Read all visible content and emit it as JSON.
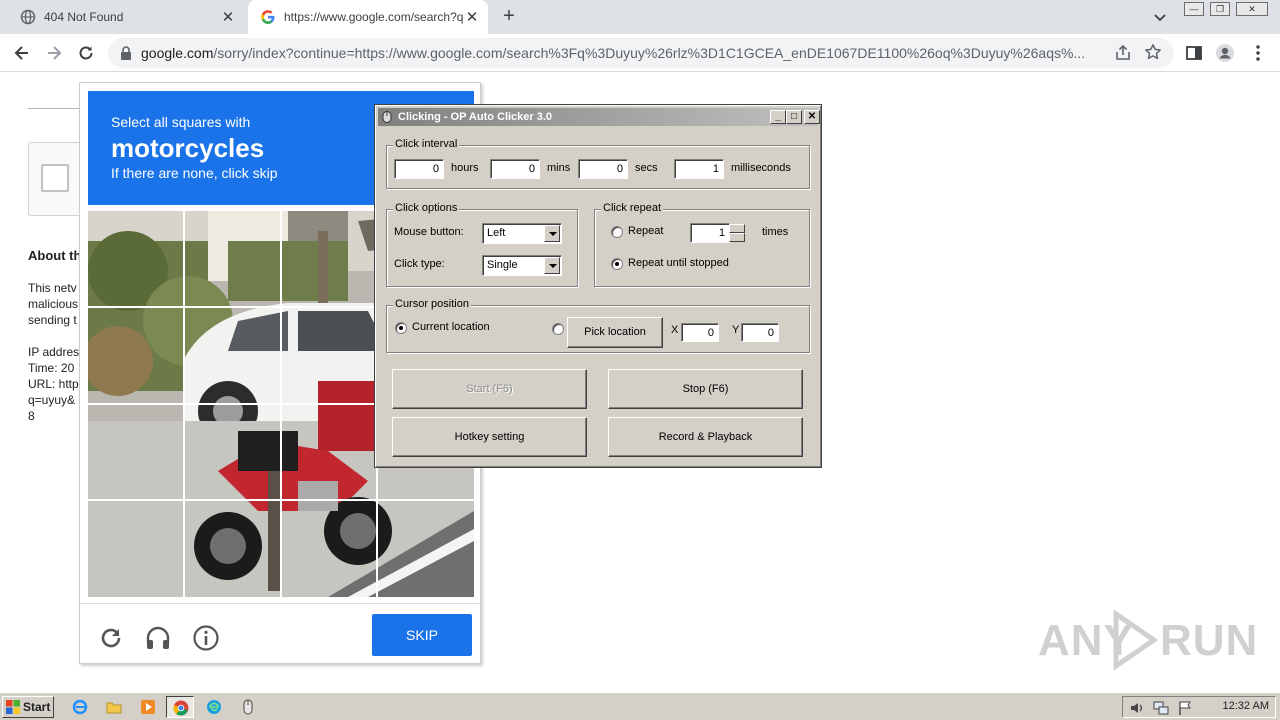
{
  "browser": {
    "tabs": [
      {
        "title": "404 Not Found",
        "active": false
      },
      {
        "title": "https://www.google.com/search?q=",
        "active": true
      }
    ],
    "url_domain": "google.com",
    "url_rest": "/sorry/index?continue=https://www.google.com/search%3Fq%3Duyuy%26rlz%3D1C1GCEA_enDE1067DE1100%26oq%3Duyuy%26aqs%..."
  },
  "page": {
    "about_heading": "About th",
    "lines_a": [
      "This netv",
      "malicious",
      "sending t"
    ],
    "lines_b": [
      "IP addres",
      "Time: 20",
      "URL: http",
      "q=uyuy&",
      "8"
    ]
  },
  "captcha": {
    "instruction": "Select all squares with",
    "target": "motorcycles",
    "subtext": "If there are none, click skip",
    "skip_label": "SKIP",
    "colors": {
      "header": "#1a73e8",
      "button": "#1a73e8"
    }
  },
  "clicker": {
    "title": "Clicking - OP Auto Clicker 3.0",
    "interval": {
      "label": "Click interval",
      "hours": "0",
      "hours_label": "hours",
      "mins": "0",
      "mins_label": "mins",
      "secs": "0",
      "secs_label": "secs",
      "ms": "1",
      "ms_label": "milliseconds"
    },
    "options": {
      "label": "Click options",
      "mouse_label": "Mouse button:",
      "mouse_value": "Left",
      "type_label": "Click type:",
      "type_value": "Single"
    },
    "repeat": {
      "label": "Click repeat",
      "repeat_label": "Repeat",
      "repeat_count": "1",
      "times_label": "times",
      "until_label": "Repeat until stopped"
    },
    "cursor": {
      "label": "Cursor position",
      "current_label": "Current location",
      "pick_label": "Pick location",
      "x_label": "X",
      "x_value": "0",
      "y_label": "Y",
      "y_value": "0"
    },
    "buttons": {
      "start": "Start (F6)",
      "stop": "Stop (F6)",
      "hotkey": "Hotkey setting",
      "record": "Record & Playback"
    }
  },
  "watermark": {
    "left": "ANY",
    "right": "RUN"
  },
  "taskbar": {
    "start_label": "Start",
    "clock": "12:32 AM"
  }
}
